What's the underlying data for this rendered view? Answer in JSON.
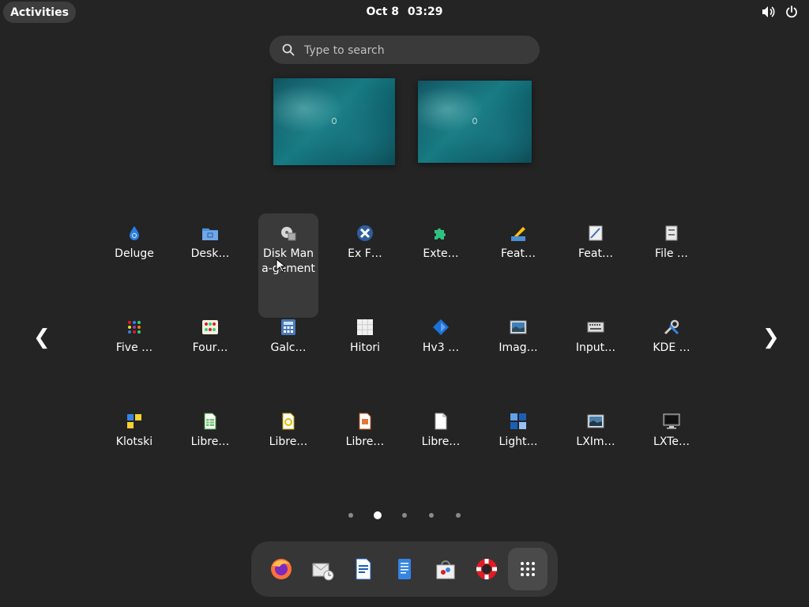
{
  "topbar": {
    "activities_label": "Activities",
    "date": "Oct 8",
    "time": "03:29",
    "icons": [
      "volume-icon",
      "power-icon"
    ]
  },
  "search": {
    "placeholder": "Type to search"
  },
  "workspaces": 2,
  "app_grid": {
    "apps": [
      {
        "label": "Deluge",
        "icon": "deluge-icon"
      },
      {
        "label": "Desk…",
        "icon": "desktop-folder-icon"
      },
      {
        "label": "Disk Mana-gement",
        "icon": "disk-management-icon",
        "hovered": true
      },
      {
        "label": "Ex F…",
        "icon": "ex-falso-icon"
      },
      {
        "label": "Exte…",
        "icon": "extensions-icon"
      },
      {
        "label": "Feat…",
        "icon": "feather-pen-icon"
      },
      {
        "label": "Feat…",
        "icon": "feather-notepad-icon"
      },
      {
        "label": "File …",
        "icon": "file-cabinet-icon"
      },
      {
        "label": "Five …",
        "icon": "five-or-more-icon"
      },
      {
        "label": "Four…",
        "icon": "four-in-a-row-icon"
      },
      {
        "label": "Galc…",
        "icon": "calculator-icon"
      },
      {
        "label": "Hitori",
        "icon": "hitori-icon"
      },
      {
        "label": "Hv3 …",
        "icon": "hv3-icon"
      },
      {
        "label": "Imag…",
        "icon": "image-viewer-icon"
      },
      {
        "label": "Input…",
        "icon": "keyboard-icon"
      },
      {
        "label": "KDE …",
        "icon": "tools-icon"
      },
      {
        "label": "Klotski",
        "icon": "klotski-icon"
      },
      {
        "label": "Libre…",
        "icon": "libreoffice-calc-icon"
      },
      {
        "label": "Libre…",
        "icon": "libreoffice-draw-icon"
      },
      {
        "label": "Libre…",
        "icon": "libreoffice-impress-icon"
      },
      {
        "label": "Libre…",
        "icon": "libreoffice-document-icon"
      },
      {
        "label": "Light…",
        "icon": "lightsoff-icon"
      },
      {
        "label": "LXIm…",
        "icon": "lximage-icon"
      },
      {
        "label": "LXTe…",
        "icon": "terminal-icon"
      }
    ]
  },
  "pager": {
    "pages": 5,
    "current": 2
  },
  "dash": {
    "items": [
      "firefox-icon",
      "evolution-mail-icon",
      "libreoffice-writer-icon",
      "text-editor-icon",
      "software-center-icon",
      "help-icon",
      "show-apps-icon"
    ]
  }
}
